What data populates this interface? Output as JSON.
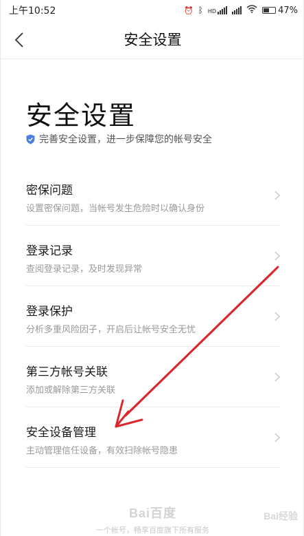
{
  "status_bar": {
    "time": "上午10:52",
    "battery": "47%",
    "battery_level": 0.47,
    "icons": [
      "bluetooth-icon",
      "signal-icon",
      "signal-icon",
      "wifi-icon",
      "alarm-icon",
      "battery-icon"
    ]
  },
  "nav": {
    "title": "安全设置",
    "back_icon": "chevron-left-icon"
  },
  "header": {
    "title": "安全设置",
    "subtitle": "完善安全设置，进一步保障您的帐号安全",
    "subtitle_icon": "shield-icon"
  },
  "items": [
    {
      "title": "密保问题",
      "desc": "设置密保问题，当帐号发生危险时以确认身份"
    },
    {
      "title": "登录记录",
      "desc": "查阅登录记录，及时发现异常"
    },
    {
      "title": "登录保护",
      "desc": "分析多重风险因子，开启后让帐号安全无忧"
    },
    {
      "title": "第三方帐号关联",
      "desc": "添加或解除第三方关联"
    },
    {
      "title": "安全设备管理",
      "desc": "主动管理信任设备，有效扫除帐号隐患"
    }
  ],
  "footer": {
    "logo": "Bai百度",
    "text": "一个帐号，畅享百度旗下所有服务"
  },
  "watermark": "Bai经验",
  "colors": {
    "accent_blue": "#4a7fe0",
    "arrow_red": "#d9272d"
  }
}
